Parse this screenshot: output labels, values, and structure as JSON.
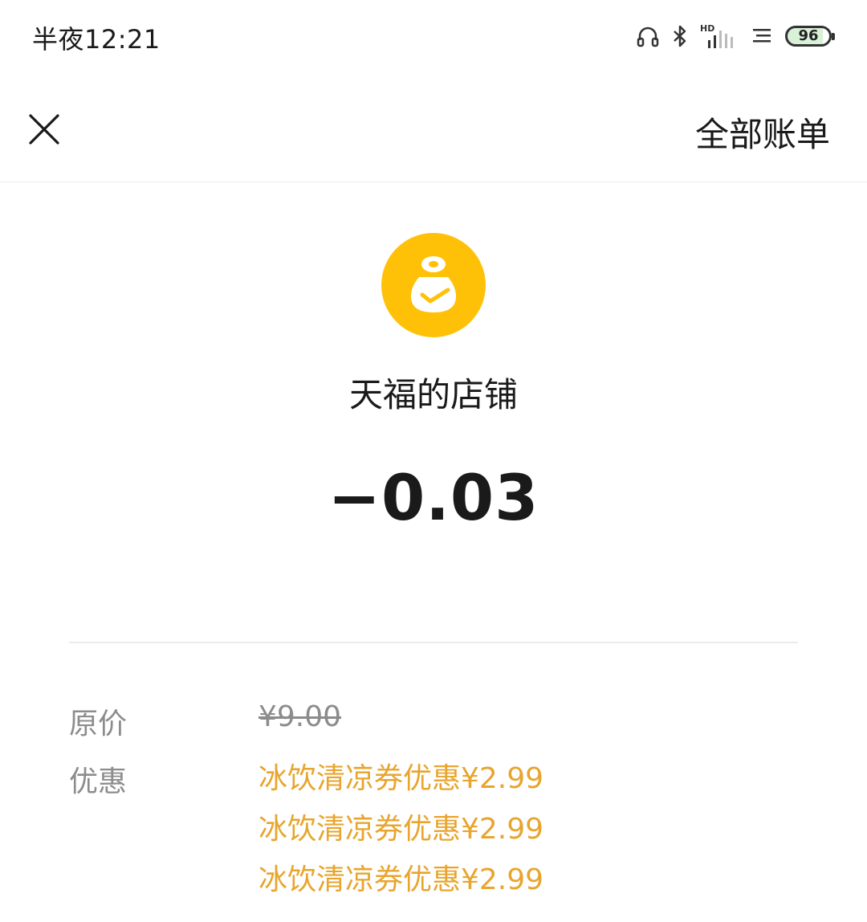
{
  "status_bar": {
    "time": "半夜12:21",
    "battery_level": "96",
    "icons": [
      "headphones-icon",
      "bluetooth-icon",
      "hd-signal-icon",
      "notification-icon",
      "battery-icon"
    ]
  },
  "nav": {
    "close_icon": "close-icon",
    "all_bills_label": "全部账单"
  },
  "merchant": {
    "logo_icon": "money-bag-check-icon",
    "name": "天福的店铺"
  },
  "transaction": {
    "amount": "−0.03"
  },
  "details": {
    "original_price_label": "原价",
    "original_price_value": "¥9.00",
    "discount_label": "优惠",
    "discounts": [
      "冰饮清凉券优惠¥2.99",
      "冰饮清凉券优惠¥2.99",
      "冰饮清凉券优惠¥2.99"
    ]
  },
  "colors": {
    "accent_yellow": "#FFC107",
    "discount_orange": "#E8A52E",
    "label_gray": "#8C8C8C"
  }
}
